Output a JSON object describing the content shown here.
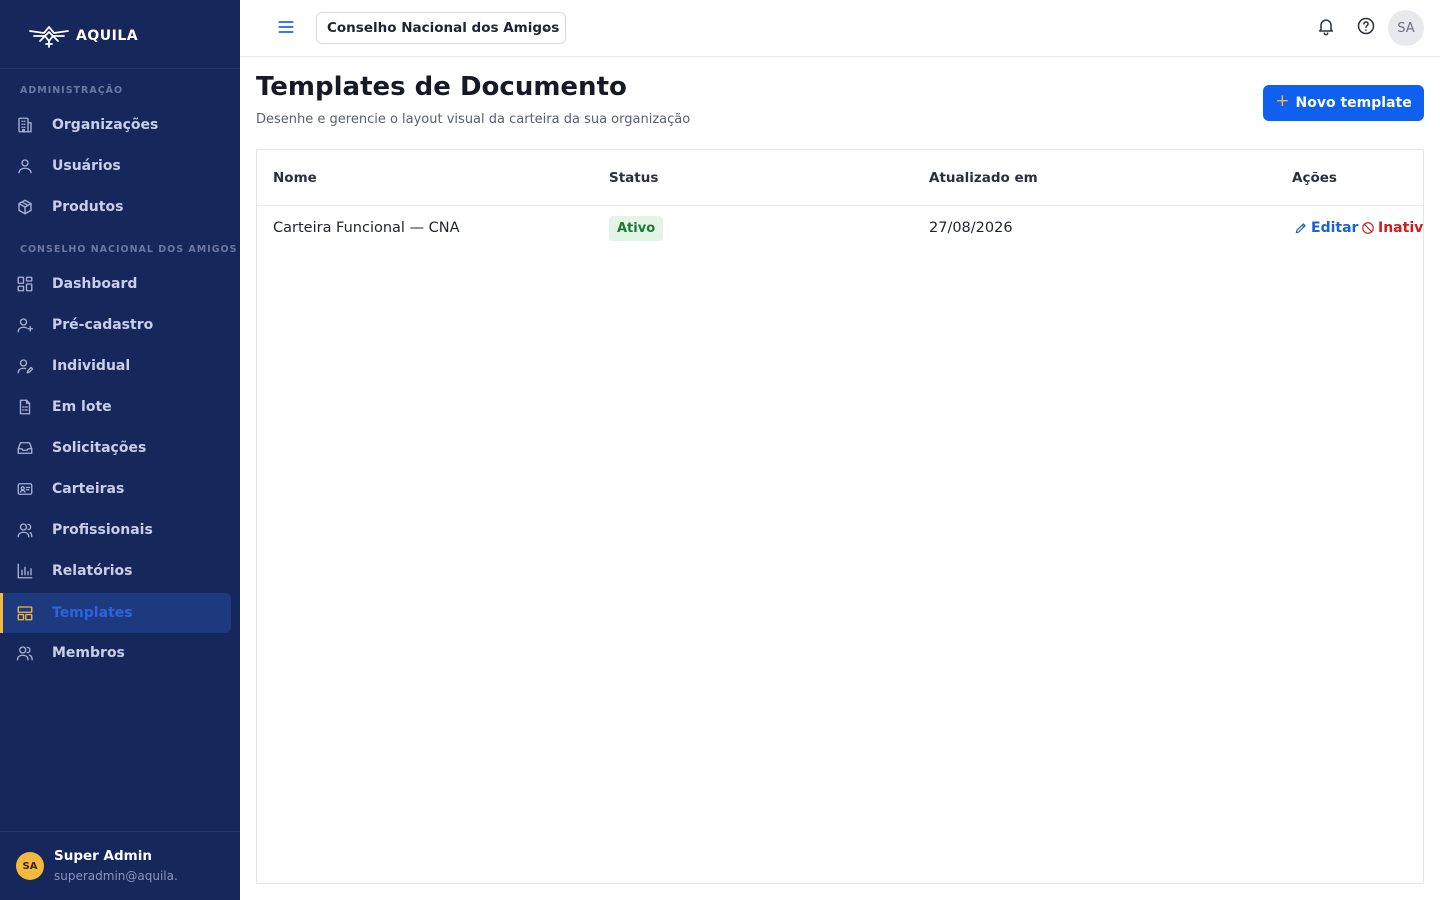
{
  "brand": {
    "name": "AQUILA"
  },
  "sidebar": {
    "sections": [
      {
        "label": "ADMINISTRAÇÃO"
      },
      {
        "label": "CONSELHO NACIONAL DOS AMIGOS"
      }
    ],
    "items": [
      {
        "label": "Organizações",
        "icon": "building-icon"
      },
      {
        "label": "Usuários",
        "icon": "user-icon"
      },
      {
        "label": "Produtos",
        "icon": "box-icon"
      },
      {
        "label": "Dashboard",
        "icon": "grid-icon"
      },
      {
        "label": "Pré-cadastro",
        "icon": "user-plus-icon"
      },
      {
        "label": "Individual",
        "icon": "user-edit-icon"
      },
      {
        "label": "Em lote",
        "icon": "file-list-icon"
      },
      {
        "label": "Solicitações",
        "icon": "inbox-icon"
      },
      {
        "label": "Carteiras",
        "icon": "id-card-icon"
      },
      {
        "label": "Profissionais",
        "icon": "users-icon"
      },
      {
        "label": "Relatórios",
        "icon": "bar-chart-icon"
      },
      {
        "label": "Templates",
        "icon": "layout-icon",
        "active": true
      },
      {
        "label": "Membros",
        "icon": "group-icon"
      }
    ],
    "user": {
      "initials": "SA",
      "name": "Super Admin",
      "email": "superadmin@aquila."
    }
  },
  "topbar": {
    "org_selected": "Conselho Nacional dos Amigos",
    "avatar_initials": "SA"
  },
  "page": {
    "title": "Templates de Documento",
    "subtitle": "Desenhe e gerencie o layout visual da carteira da sua organização",
    "new_button": "Novo template"
  },
  "table": {
    "columns": [
      "Nome",
      "Status",
      "Atualizado em",
      "Ações"
    ],
    "rows": [
      {
        "name": "Carteira Funcional — CNA",
        "status": "Ativo",
        "updated": "27/08/2026",
        "edit": "Editar",
        "deactivate": "Inativa"
      }
    ]
  },
  "colors": {
    "sidebar_bg": "#16275c",
    "accent": "#f5b93d",
    "primary": "#1060f0",
    "success": "#1b7a35",
    "danger": "#d01c1c"
  }
}
